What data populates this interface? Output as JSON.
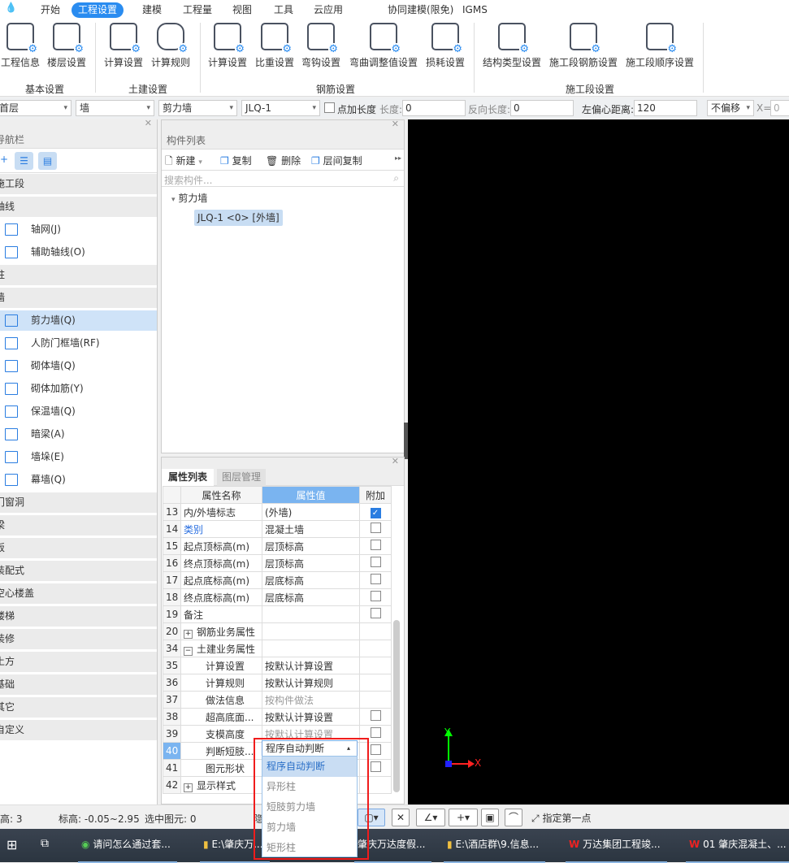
{
  "menu_tabs": [
    "开始",
    "工程设置",
    "建模",
    "工程量",
    "视图",
    "工具",
    "云应用",
    "协同建模(限免)",
    "IGMS"
  ],
  "active_tab": "工程设置",
  "ribbon": {
    "groups": [
      "基本设置",
      "土建设置",
      "钢筋设置",
      "施工段设置"
    ],
    "buttons": [
      "工程信息",
      "楼层设置",
      "计算设置",
      "计算规则",
      "计算设置",
      "比重设置",
      "弯钩设置",
      "弯曲调整值设置",
      "损耗设置",
      "结构类型设置",
      "施工段钢筋设置",
      "施工段顺序设置"
    ]
  },
  "toolbar": {
    "floor": "首层",
    "type": "墙",
    "subtype": "剪力墙",
    "component": "JLQ-1",
    "add_length": "点加长度",
    "length_label": "长度:",
    "length": "0",
    "rev_length_label": "反向长度:",
    "rev_length": "0",
    "offset_label": "左偏心距离:",
    "offset": "120",
    "shift": "不偏移",
    "x_label": "X=",
    "x": "0"
  },
  "nav": {
    "title": "导航栏",
    "items": [
      {
        "label": "施工段",
        "type": "cat"
      },
      {
        "label": "轴线",
        "type": "cat"
      },
      {
        "label": "轴网(J)",
        "type": "sub"
      },
      {
        "label": "辅助轴线(O)",
        "type": "sub"
      },
      {
        "label": "柱",
        "type": "cat"
      },
      {
        "label": "墙",
        "type": "cat"
      },
      {
        "label": "剪力墙(Q)",
        "type": "sub",
        "selected": true
      },
      {
        "label": "人防门框墙(RF)",
        "type": "sub"
      },
      {
        "label": "砌体墙(Q)",
        "type": "sub"
      },
      {
        "label": "砌体加筋(Y)",
        "type": "sub"
      },
      {
        "label": "保温墙(Q)",
        "type": "sub"
      },
      {
        "label": "暗梁(A)",
        "type": "sub"
      },
      {
        "label": "墙垛(E)",
        "type": "sub"
      },
      {
        "label": "幕墙(Q)",
        "type": "sub"
      },
      {
        "label": "门窗洞",
        "type": "cat"
      },
      {
        "label": "梁",
        "type": "cat"
      },
      {
        "label": "板",
        "type": "cat"
      },
      {
        "label": "装配式",
        "type": "cat"
      },
      {
        "label": "空心楼盖",
        "type": "cat"
      },
      {
        "label": "楼梯",
        "type": "cat"
      },
      {
        "label": "装修",
        "type": "cat"
      },
      {
        "label": "土方",
        "type": "cat"
      },
      {
        "label": "基础",
        "type": "cat"
      },
      {
        "label": "其它",
        "type": "cat"
      },
      {
        "label": "自定义",
        "type": "cat"
      }
    ]
  },
  "complist": {
    "title": "构件列表",
    "new": "新建",
    "copy": "复制",
    "delete": "删除",
    "floor_copy": "层间复制",
    "search_placeholder": "搜索构件...",
    "group": "剪力墙",
    "item": "JLQ-1 <0> [外墙]"
  },
  "props": {
    "tab_active": "属性列表",
    "tab_other": "图层管理",
    "headers": [
      "属性名称",
      "属性值",
      "附加"
    ],
    "rows": [
      {
        "n": "13",
        "name": "内/外墙标志",
        "value": "(外墙)",
        "check": "checked"
      },
      {
        "n": "14",
        "name": "类别",
        "value": "混凝土墙",
        "check": "empty",
        "link": true
      },
      {
        "n": "15",
        "name": "起点顶标高(m)",
        "value": "层顶标高",
        "check": "empty"
      },
      {
        "n": "16",
        "name": "终点顶标高(m)",
        "value": "层顶标高",
        "check": "empty"
      },
      {
        "n": "17",
        "name": "起点底标高(m)",
        "value": "层底标高",
        "check": "empty"
      },
      {
        "n": "18",
        "name": "终点底标高(m)",
        "value": "层底标高",
        "check": "empty"
      },
      {
        "n": "19",
        "name": "备注",
        "value": "",
        "check": "empty"
      },
      {
        "n": "20",
        "name": "钢筋业务属性",
        "value": "",
        "expand": "+"
      },
      {
        "n": "34",
        "name": "土建业务属性",
        "value": "",
        "expand": "-"
      },
      {
        "n": "35",
        "name": "计算设置",
        "value": "按默认计算设置",
        "child": true
      },
      {
        "n": "36",
        "name": "计算规则",
        "value": "按默认计算规则",
        "child": true
      },
      {
        "n": "37",
        "name": "做法信息",
        "value": "按构件做法",
        "child": true,
        "gray": true
      },
      {
        "n": "38",
        "name": "超高底面...",
        "value": "按默认计算设置",
        "child": true,
        "check": "empty"
      },
      {
        "n": "39",
        "name": "支模高度",
        "value": "按默认计算设置",
        "child": true,
        "gray": true,
        "check": "empty"
      },
      {
        "n": "40",
        "name": "判断短肢...",
        "value": "程序自动判断",
        "child": true,
        "check": "empty",
        "active": true
      },
      {
        "n": "41",
        "name": "图元形状",
        "value": "",
        "child": true,
        "check": "empty"
      },
      {
        "n": "42",
        "name": "显示样式",
        "value": "",
        "expand": "+"
      }
    ]
  },
  "dropdown": {
    "options": [
      "程序自动判断",
      "异形柱",
      "短肢剪力墙",
      "剪力墙",
      "矩形柱"
    ],
    "selected": "程序自动判断"
  },
  "status": {
    "floor_height_label": "层高:",
    "floor_height": "3",
    "elev_label": "标高:",
    "elev": "-0.05~2.95",
    "selected_label": "选中图元:",
    "selected": "0",
    "hidden": "隐藏",
    "prompt": "指定第一点"
  },
  "taskbar": [
    "请问怎么通过套...",
    "E:\\肇庆万...",
    "肇庆万达度假...",
    "E:\\酒店群\\9.信息...",
    "万达集团工程竣...",
    "01 肇庆混凝土、..."
  ],
  "axis": {
    "x": "X",
    "y": "Y"
  },
  "colors": {
    "accent": "#2a8cf0",
    "highlight_box": "#f01c1c",
    "canvas": "#000000"
  }
}
